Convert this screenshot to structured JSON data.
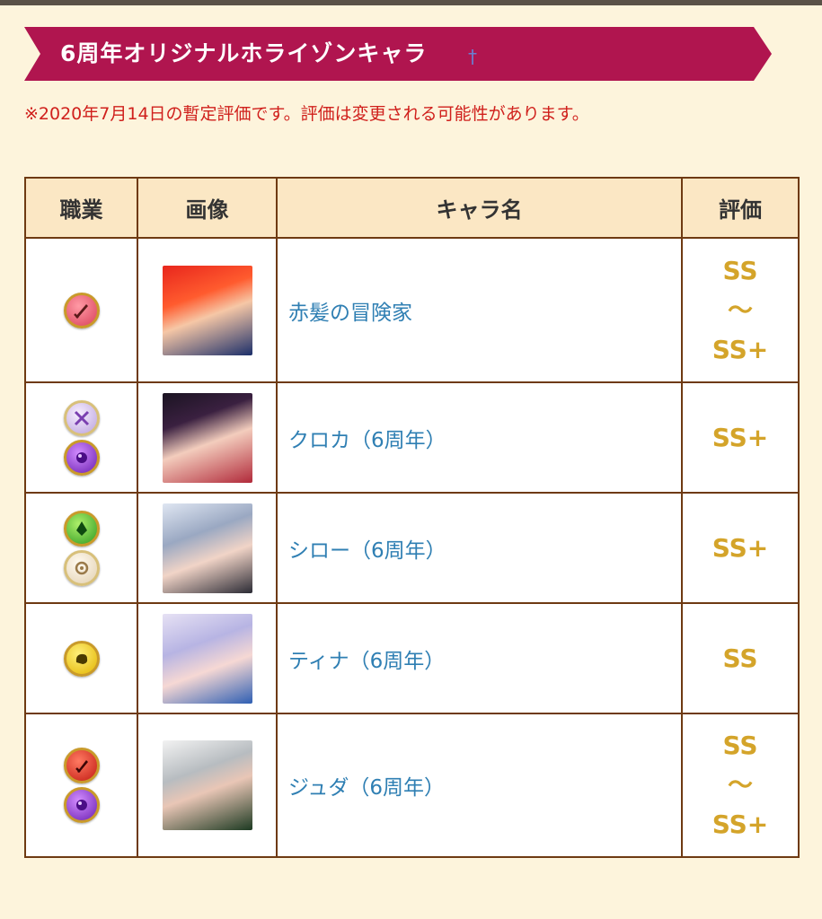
{
  "banner": {
    "title": "6周年オリジナルホライゾンキャラ",
    "mark": "†"
  },
  "notice": "※2020年7月14日の暫定評価です。評価は変更される可能性があります。",
  "table": {
    "headers": {
      "job": "職業",
      "image": "画像",
      "name": "キャラ名",
      "rating": "評価"
    },
    "rows": [
      {
        "name": "赤髪の冒険家",
        "rating": [
          "SS",
          "〜",
          "SS+"
        ],
        "job_icons": [
          "pink-sword-icon"
        ]
      },
      {
        "name": "クロカ（6周年）",
        "rating": [
          "SS+"
        ],
        "job_icons": [
          "lavender-crossed-swords-icon",
          "purple-orb-icon"
        ]
      },
      {
        "name": "シロー（6周年）",
        "rating": [
          "SS+"
        ],
        "job_icons": [
          "green-bell-icon",
          "cream-gear-icon"
        ]
      },
      {
        "name": "ティナ（6周年）",
        "rating": [
          "SS"
        ],
        "job_icons": [
          "yellow-beast-icon"
        ]
      },
      {
        "name": "ジュダ（6周年）",
        "rating": [
          "SS",
          "〜",
          "SS+"
        ],
        "job_icons": [
          "red-blade-icon",
          "purple-orb-icon"
        ]
      }
    ]
  },
  "colors": {
    "banner": "#b0154f",
    "notice": "#d0201c",
    "link": "#2f7fb3",
    "grade": "#d4a42a",
    "header_bg": "#fbe7c4",
    "page_bg": "#fdf4dc",
    "border": "#6e3a12"
  }
}
